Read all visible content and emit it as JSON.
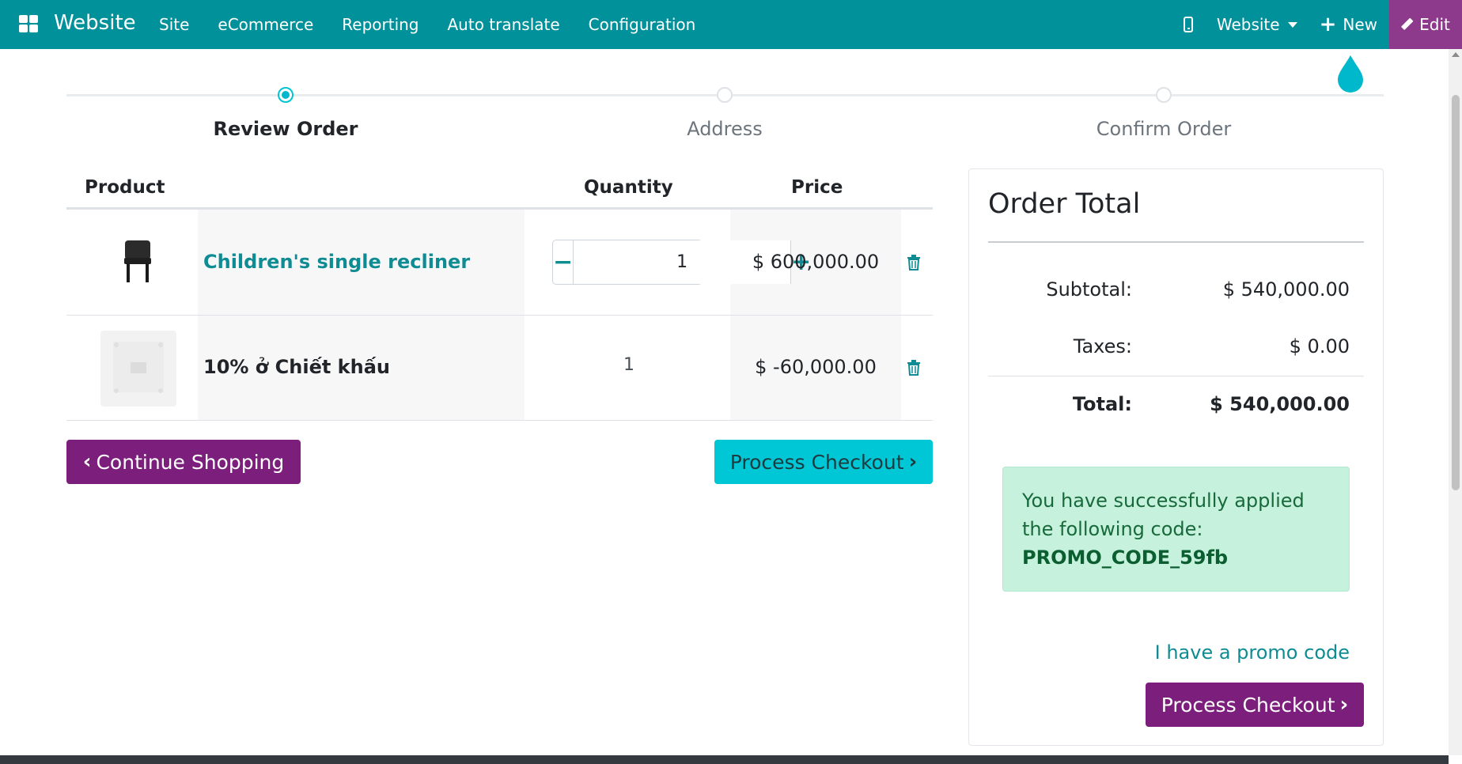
{
  "topbar": {
    "app_name": "Website",
    "menu": [
      "Site",
      "eCommerce",
      "Reporting",
      "Auto translate",
      "Configuration"
    ],
    "website_selector": "Website",
    "new_label": "New",
    "edit_label": "Edit",
    "bg_color": "#01919a",
    "edit_color": "#8e3a8c"
  },
  "wizard": {
    "steps": [
      {
        "label": "Review Order",
        "state": "active"
      },
      {
        "label": "Address",
        "state": "pending"
      },
      {
        "label": "Confirm Order",
        "state": "pending"
      }
    ]
  },
  "cart": {
    "headers": {
      "product": "Product",
      "quantity": "Quantity",
      "price": "Price"
    },
    "rows": [
      {
        "name": "Children's single recliner",
        "quantity": "1",
        "price": "$ 600,000.00",
        "image": "chair-thumbnail",
        "editable_qty": true
      },
      {
        "name": "10% ở Chiết khấu",
        "quantity": "1",
        "price": "$ -60,000.00",
        "image": "discount-placeholder-thumbnail",
        "editable_qty": false
      }
    ],
    "qty_minus": "−",
    "qty_plus": "+",
    "continue_label": "Continue Shopping",
    "checkout_label": "Process Checkout"
  },
  "order_total": {
    "title": "Order Total",
    "subtotal_label": "Subtotal:",
    "subtotal_value": "$ 540,000.00",
    "taxes_label": "Taxes:",
    "taxes_value": "$ 0.00",
    "total_label": "Total:",
    "total_value": "$ 540,000.00",
    "promo_message": "You have successfully applied the following code:",
    "promo_code": "PROMO_CODE_59fb",
    "promo_link": "I have a promo code",
    "checkout_label": "Process Checkout"
  },
  "icons": {
    "chevron_left": "‹",
    "chevron_right": "›"
  }
}
